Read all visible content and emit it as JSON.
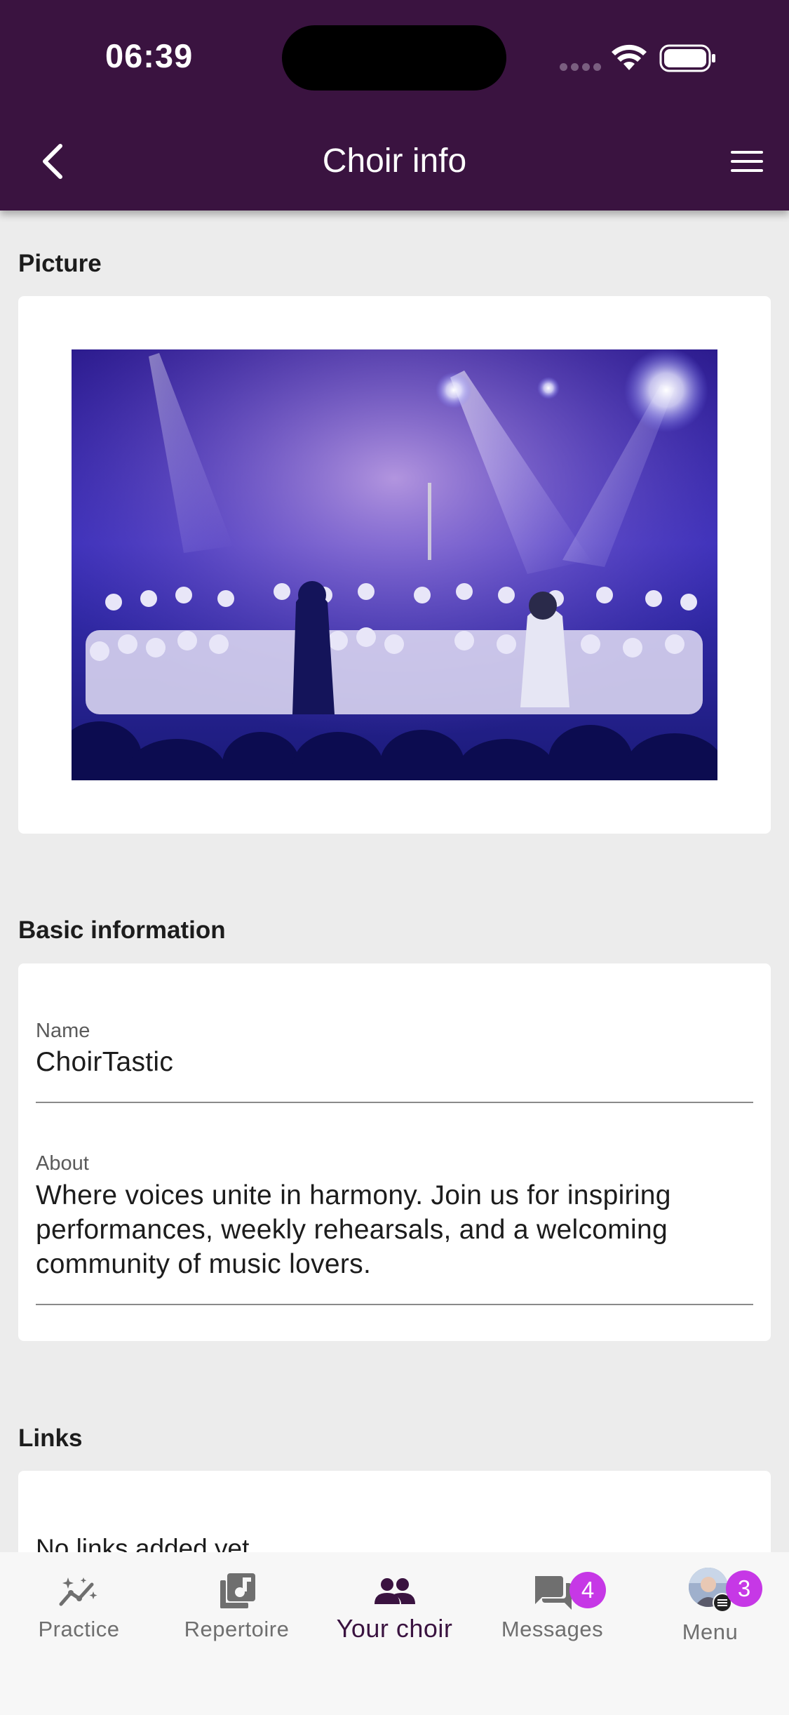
{
  "status_bar": {
    "time": "06:39"
  },
  "header": {
    "title": "Choir info",
    "back_icon": "chevron-left-icon",
    "menu_icon": "hamburger-icon",
    "background_color": "#3a1340"
  },
  "sections": {
    "picture_label": "Picture",
    "basic_info_label": "Basic information",
    "links_label": "Links"
  },
  "basic_information": {
    "name_label": "Name",
    "name_value": "ChoirTastic",
    "about_label": "About",
    "about_value": "Where voices unite in harmony. Join us for inspiring performances, weekly rehearsals, and a welcoming community of music lovers."
  },
  "links": {
    "empty_text": "No links added yet"
  },
  "tabbar": {
    "tabs": [
      {
        "label": "Practice",
        "icon": "sparkle-chart-icon"
      },
      {
        "label": "Repertoire",
        "icon": "music-library-icon"
      },
      {
        "label": "Your choir",
        "icon": "group-icon",
        "active": true
      },
      {
        "label": "Messages",
        "icon": "chat-icon",
        "badge": "4"
      },
      {
        "label": "Menu",
        "icon": "avatar-icon",
        "badge": "3"
      }
    ],
    "active_color": "#3a1340",
    "badge_color": "#c638e6"
  }
}
